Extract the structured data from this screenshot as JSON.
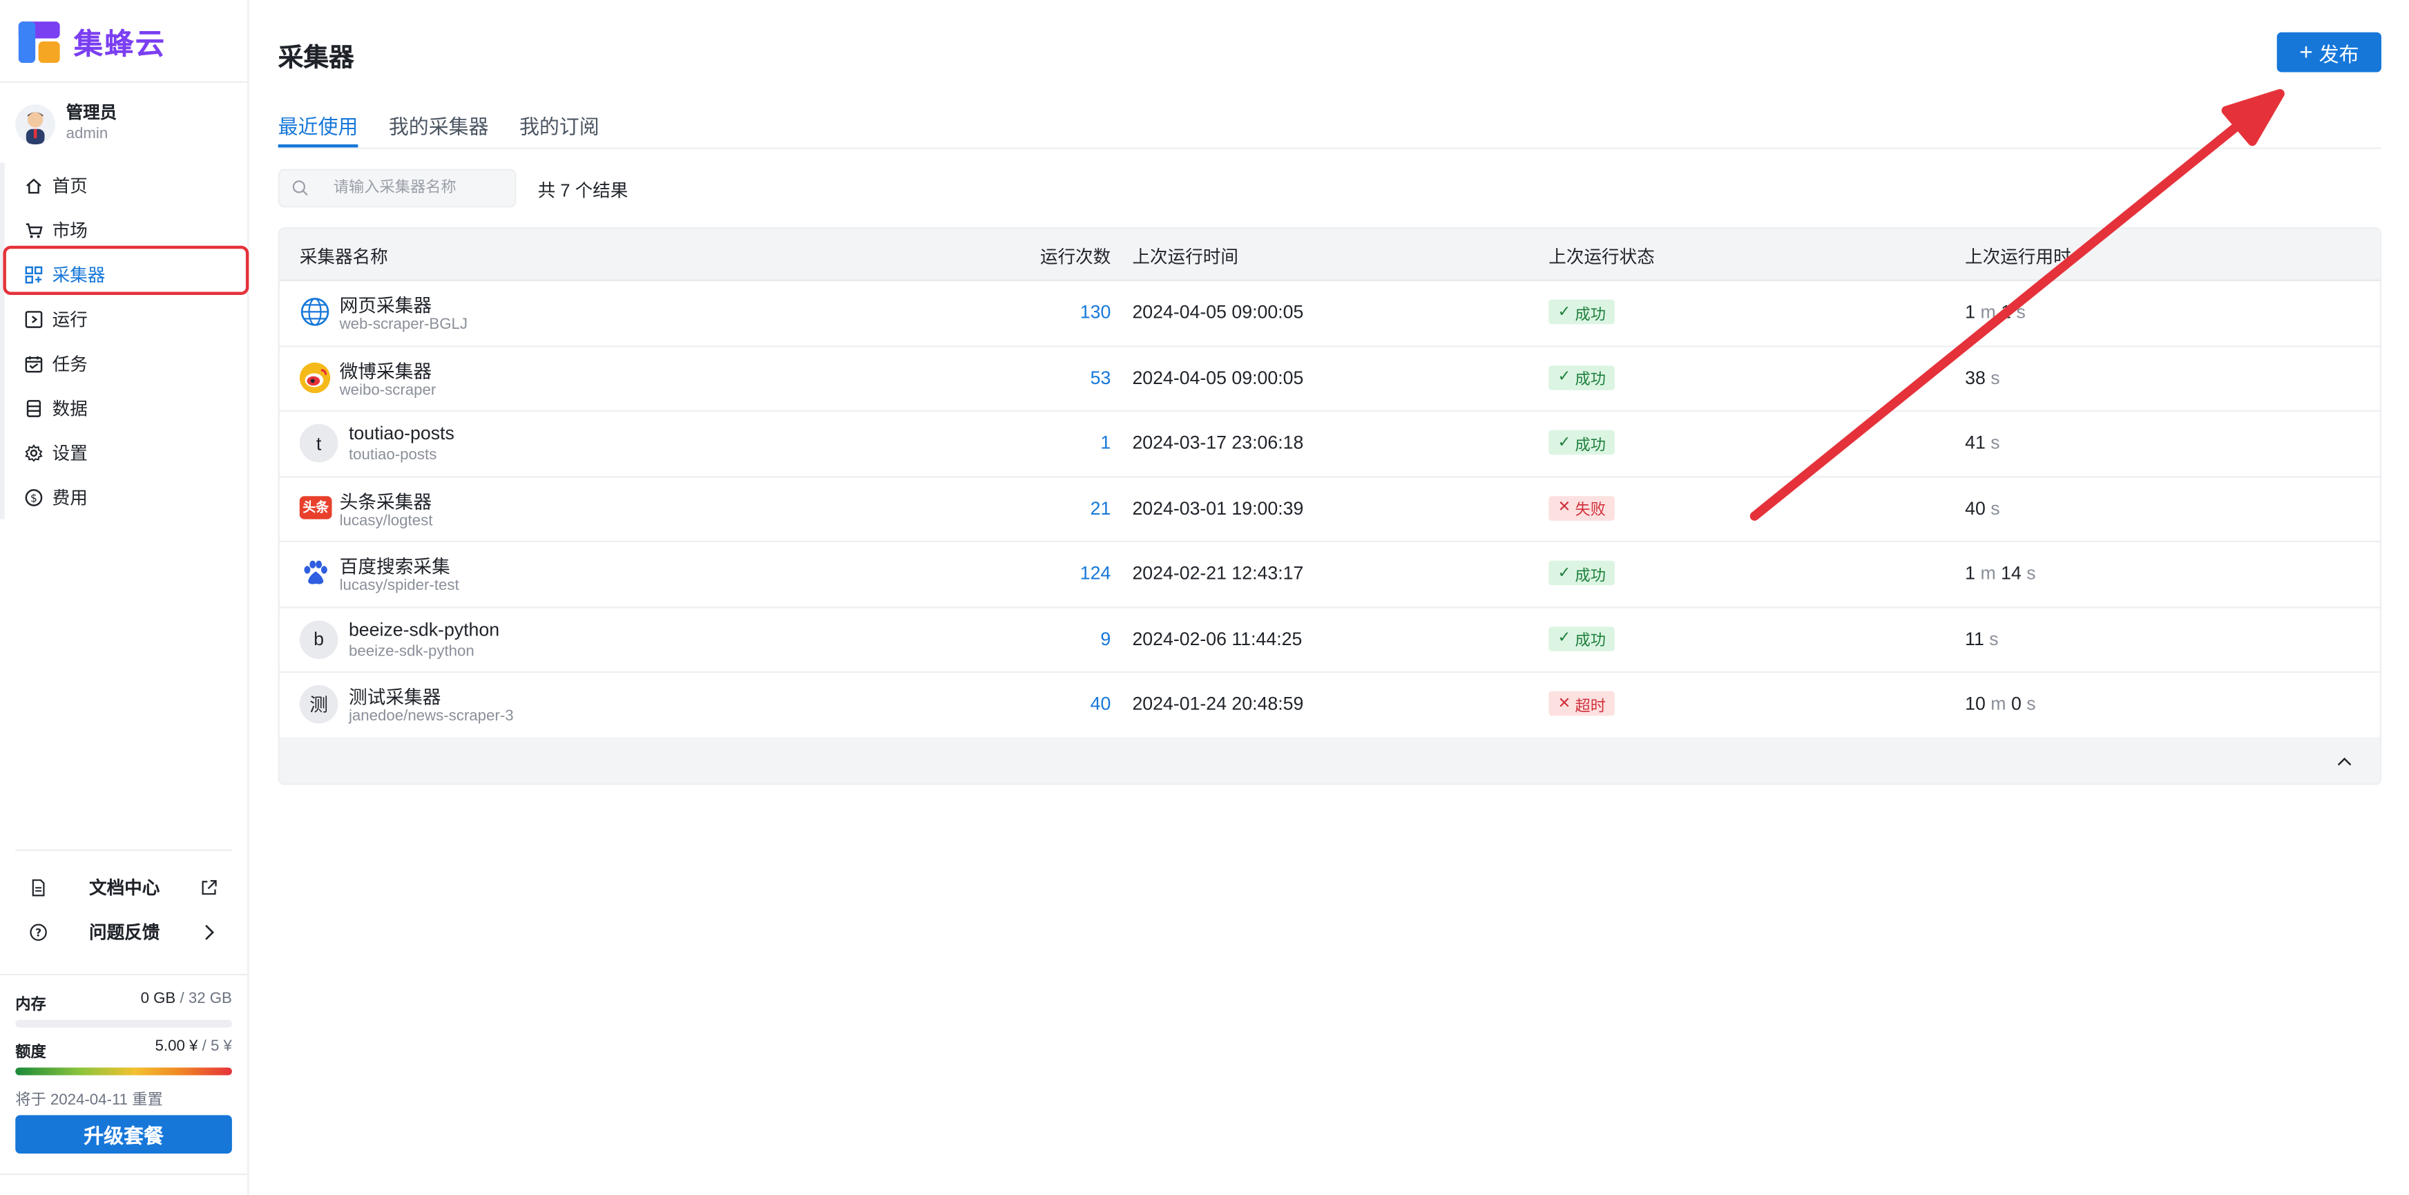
{
  "brand": {
    "name": "集蜂云"
  },
  "user": {
    "name": "管理员",
    "username": "admin"
  },
  "nav": [
    {
      "label": "首页",
      "icon": "home-icon",
      "active": false
    },
    {
      "label": "市场",
      "icon": "cart-icon",
      "active": false
    },
    {
      "label": "采集器",
      "icon": "scraper-icon",
      "active": true
    },
    {
      "label": "运行",
      "icon": "run-icon",
      "active": false
    },
    {
      "label": "任务",
      "icon": "task-icon",
      "active": false
    },
    {
      "label": "数据",
      "icon": "data-icon",
      "active": false
    },
    {
      "label": "设置",
      "icon": "gear-icon",
      "active": false
    },
    {
      "label": "费用",
      "icon": "dollar-icon",
      "active": false
    }
  ],
  "bottom_links": [
    {
      "label": "文档中心",
      "icon": "document-icon",
      "trailing_icon": "external-link-icon"
    },
    {
      "label": "问题反馈",
      "icon": "help-icon",
      "trailing_icon": "chevron-right-icon"
    }
  ],
  "usage": {
    "memory_label": "内存",
    "memory_used": "0 GB",
    "memory_total": "/ 32 GB",
    "memory_fraction": 0,
    "quota_label": "额度",
    "quota_used": "5.00 ¥",
    "quota_total": "/ 5 ¥",
    "quota_fraction": 1,
    "reset_text": "将于 2024-04-11 重置",
    "upgrade_label": "升级套餐"
  },
  "page": {
    "title": "采集器",
    "publish_label": "发布",
    "tabs": [
      {
        "label": "最近使用",
        "active": true
      },
      {
        "label": "我的采集器",
        "active": false
      },
      {
        "label": "我的订阅",
        "active": false
      }
    ],
    "search_placeholder": "请输入采集器名称",
    "result_count": "共 7 个结果"
  },
  "table": {
    "headers": [
      "采集器名称",
      "运行次数",
      "上次运行时间",
      "上次运行状态",
      "上次运行用时"
    ],
    "rows": [
      {
        "name": "网页采集器",
        "slug": "web-scraper-BGLJ",
        "icon": "globe-icon",
        "runs": "130",
        "last_run": "2024-04-05 09:00:05",
        "status": "成功",
        "status_type": "ok",
        "duration": [
          [
            "1",
            "m"
          ],
          [
            "1",
            "s"
          ]
        ]
      },
      {
        "name": "微博采集器",
        "slug": "weibo-scraper",
        "icon": "weibo-icon",
        "runs": "53",
        "last_run": "2024-04-05 09:00:05",
        "status": "成功",
        "status_type": "ok",
        "duration": [
          [
            "38",
            "s"
          ]
        ]
      },
      {
        "name": "toutiao-posts",
        "slug": "toutiao-posts",
        "icon": "letter-avatar",
        "letter": "t",
        "runs": "1",
        "last_run": "2024-03-17 23:06:18",
        "status": "成功",
        "status_type": "ok",
        "duration": [
          [
            "41",
            "s"
          ]
        ]
      },
      {
        "name": "头条采集器",
        "slug": "lucasy/logtest",
        "icon": "toutiao-icon",
        "icon_text": "头条",
        "runs": "21",
        "last_run": "2024-03-01 19:00:39",
        "status": "失败",
        "status_type": "fail",
        "duration": [
          [
            "40",
            "s"
          ]
        ]
      },
      {
        "name": "百度搜索采集",
        "slug": "lucasy/spider-test",
        "icon": "baidu-paw-icon",
        "runs": "124",
        "last_run": "2024-02-21 12:43:17",
        "status": "成功",
        "status_type": "ok",
        "duration": [
          [
            "1",
            "m"
          ],
          [
            "14",
            "s"
          ]
        ]
      },
      {
        "name": "beeize-sdk-python",
        "slug": "beeize-sdk-python",
        "icon": "letter-avatar",
        "letter": "b",
        "runs": "9",
        "last_run": "2024-02-06 11:44:25",
        "status": "成功",
        "status_type": "ok",
        "duration": [
          [
            "11",
            "s"
          ]
        ]
      },
      {
        "name": "测试采集器",
        "slug": "janedoe/news-scraper-3",
        "icon": "letter-avatar",
        "letter": "测",
        "runs": "40",
        "last_run": "2024-01-24 20:48:59",
        "status": "超时",
        "status_type": "fail",
        "duration": [
          [
            "10",
            "m"
          ],
          [
            "0",
            "s"
          ]
        ]
      }
    ]
  },
  "colors": {
    "accent": "#1677d9",
    "brand": "#7b3ff2",
    "annotation": "#e5323a",
    "success": "#1e7f3c",
    "danger": "#d0303a"
  }
}
